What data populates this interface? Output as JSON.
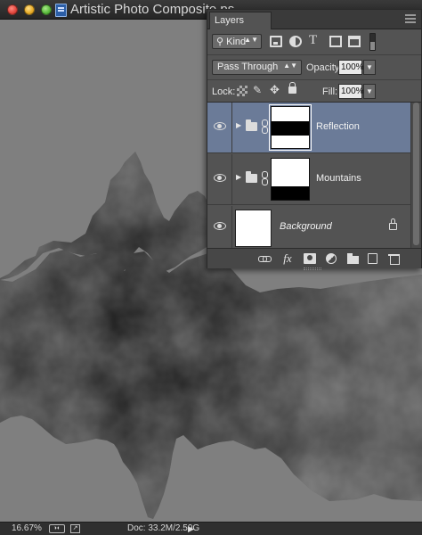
{
  "window": {
    "title": "Artistic Photo Composite.ps"
  },
  "layers_panel": {
    "tab_label": "Layers",
    "kind_filter": "Kind",
    "filter_icons": [
      "pixel-layer-filter-icon",
      "adjustment-layer-filter-icon",
      "type-layer-filter-icon",
      "shape-layer-filter-icon",
      "smart-object-filter-icon"
    ],
    "blend_mode": "Pass Through",
    "opacity_label": "Opacity:",
    "opacity_value": "100%",
    "lock_label": "Lock:",
    "fill_label": "Fill:",
    "fill_value": "100%",
    "selection_color": "#6b7b98",
    "layers": [
      {
        "name": "Reflection",
        "type": "group",
        "visible": true,
        "selected": true,
        "has_mask": true,
        "mask_band": "middle"
      },
      {
        "name": "Mountains",
        "type": "group",
        "visible": true,
        "selected": false,
        "has_mask": true,
        "mask_band": "bottom"
      },
      {
        "name": "Background",
        "type": "background",
        "visible": true,
        "selected": false,
        "locked": true
      }
    ],
    "footer_icons": [
      "link-layers-icon",
      "fx-icon",
      "add-mask-icon",
      "adjustment-icon",
      "new-group-icon",
      "new-layer-icon",
      "trash-icon"
    ]
  },
  "status_bar": {
    "zoom": "16.67%",
    "doc_info": "Doc: 33.2M/2.59G"
  }
}
